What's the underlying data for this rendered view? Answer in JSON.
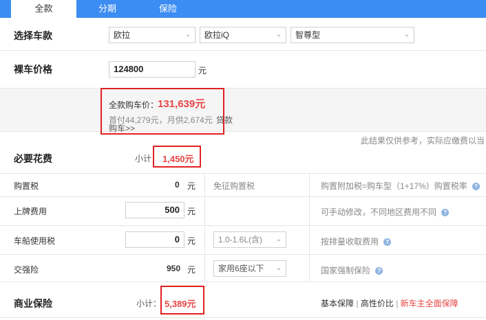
{
  "tabs": {
    "full": "全款",
    "installment": "分期",
    "insurance": "保险"
  },
  "select_model": {
    "label": "选择车款",
    "brand": "欧拉",
    "series": "欧拉iQ",
    "trim": "智尊型"
  },
  "bare_price": {
    "label": "裸车价格",
    "value": "124800",
    "unit": "元"
  },
  "summary": {
    "total_label": "全款购车价：",
    "total_value": "131,639元",
    "installment_text": "首付44,279元，月供2,674元",
    "loan_label": "贷款",
    "loan_link": "购车>>",
    "disclaimer": "此结果仅供参考，实际应缴费以当"
  },
  "required": {
    "title": "必要花费",
    "subtotal_label": "小计：",
    "subtotal_value": "1,450元",
    "rows": [
      {
        "name": "购置税",
        "value": "0",
        "unit": "元",
        "option": "免征购置税",
        "note": "购置附加税=购车型（1+17%）购置税率"
      },
      {
        "name": "上牌费用",
        "value": "500",
        "unit": "元",
        "option": "",
        "note": "可手动修改，不同地区费用不同"
      },
      {
        "name": "车船使用税",
        "value": "0",
        "unit": "元",
        "option": "1.0-1.6L(含)",
        "note": "按排量收取费用"
      },
      {
        "name": "交强险",
        "value": "950",
        "unit": "元",
        "option": "家用6座以下",
        "note": "国家强制保险"
      }
    ]
  },
  "commercial": {
    "title": "商业保险",
    "subtotal_label": "小计：",
    "subtotal_value": "5,389元",
    "opt_basic": "基本保障",
    "opt_value": "高性价比",
    "opt_new": "新车主全面保障",
    "sep": "|"
  },
  "colors": {
    "tab_blue": "#3c8df3",
    "accent_red": "#e64545",
    "frame_red": "#e02020"
  }
}
